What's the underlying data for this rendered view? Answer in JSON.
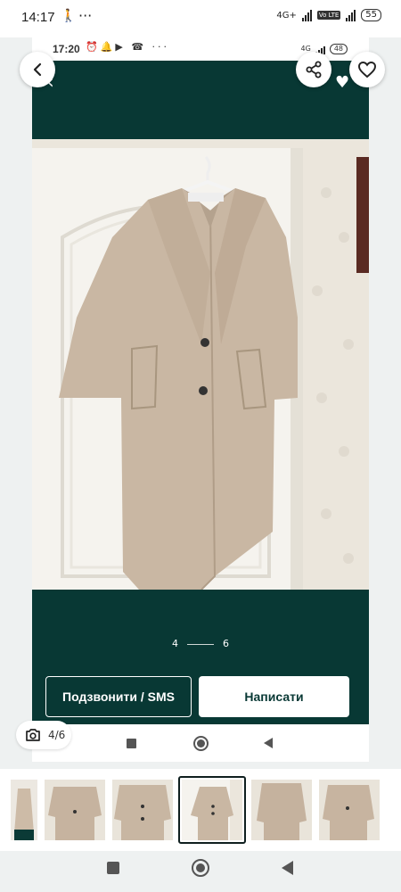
{
  "status_bar": {
    "time": "14:17",
    "network": "4G+",
    "volte": "Vo LTE",
    "battery": "55"
  },
  "inner_screenshot": {
    "status_time": "17:20",
    "network": "4G",
    "battery": "48",
    "photo_description_icon": "coat-photo",
    "pager": {
      "previous": "4",
      "next": "6"
    },
    "call_button_label": "Подзвонити / SMS",
    "write_button_label": "Написати",
    "accent_color": "#083834"
  },
  "gallery": {
    "counter": "4/6",
    "selected_index": 4,
    "thumbnail_count": 6
  }
}
